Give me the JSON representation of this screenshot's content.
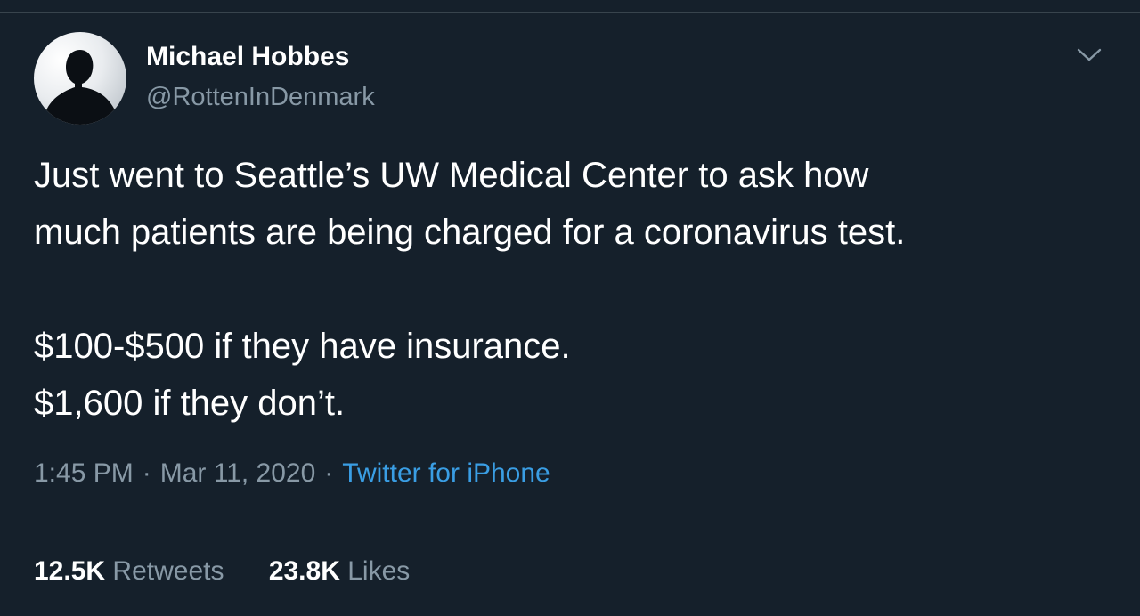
{
  "author": {
    "name": "Michael Hobbes",
    "handle": "@RottenInDenmark",
    "avatar_icon": "profile-silhouette-avatar"
  },
  "tweet": {
    "text": "Just went to Seattle’s UW Medical Center to ask how\nmuch patients are being charged for a coronavirus test.\n\n$100-$500 if they have insurance.\n$1,600 if they don’t."
  },
  "meta": {
    "time": "1:45 PM",
    "separator": "·",
    "date": "Mar 11, 2020",
    "source": "Twitter for iPhone"
  },
  "stats": {
    "retweets_count": "12.5K",
    "retweets_label": "Retweets",
    "likes_count": "23.8K",
    "likes_label": "Likes"
  },
  "colors": {
    "background": "#15202b",
    "primary_text": "#ffffff",
    "secondary_text": "#8899a6",
    "link": "#3a9ee4",
    "divider": "#38444d"
  },
  "icons": {
    "menu": "chevron-down-icon"
  }
}
